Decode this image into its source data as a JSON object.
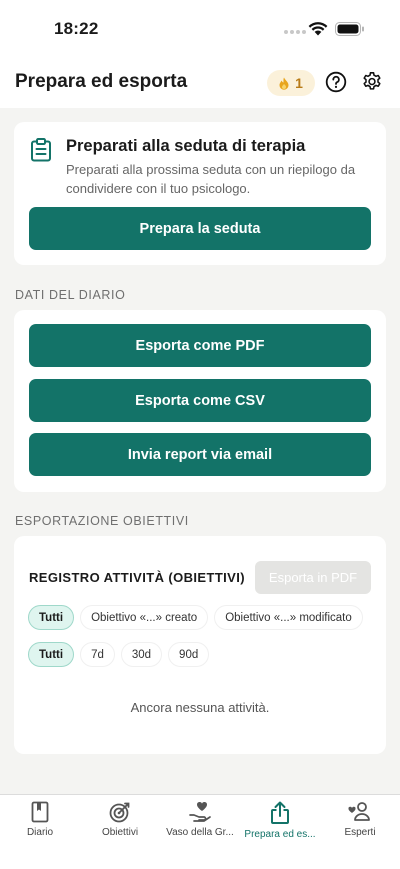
{
  "status_bar": {
    "time": "18:22"
  },
  "header": {
    "title": "Prepara ed esporta",
    "streak_count": "1"
  },
  "prepare_card": {
    "title": "Preparati alla seduta di terapia",
    "description": "Preparati alla prossima seduta con un riepilogo da condividere con il tuo psicologo.",
    "button_label": "Prepara la seduta"
  },
  "diary_section": {
    "label": "DATI DEL DIARIO",
    "buttons": [
      "Esporta come PDF",
      "Esporta come CSV",
      "Invia report via email"
    ]
  },
  "goals_section": {
    "label": "ESPORTAZIONE OBIETTIVI",
    "log_title": "REGISTRO ATTIVITÀ (OBIETTIVI)",
    "export_button": "Esporta in PDF",
    "type_filters": [
      "Tutti",
      "Obiettivo «...» creato",
      "Obiettivo «...» modificato"
    ],
    "range_filters": [
      "Tutti",
      "7d",
      "30d",
      "90d"
    ],
    "selected_type": "Tutti",
    "selected_range": "Tutti",
    "empty_text": "Ancora nessuna attività."
  },
  "tab_bar": {
    "tabs": [
      {
        "label": "Diario",
        "icon": "book-icon"
      },
      {
        "label": "Obiettivi",
        "icon": "target-icon"
      },
      {
        "label": "Vaso della Gr...",
        "icon": "heart-hand-icon"
      },
      {
        "label": "Prepara ed es...",
        "icon": "share-icon"
      },
      {
        "label": "Esperti",
        "icon": "people-icon"
      }
    ],
    "active_index": 3
  },
  "colors": {
    "primary": "#137368",
    "background": "#f4f4f2",
    "chip_active": "#dff5ef",
    "streak_badge": "#fbf1da",
    "disabled": "#e4e4e2"
  }
}
